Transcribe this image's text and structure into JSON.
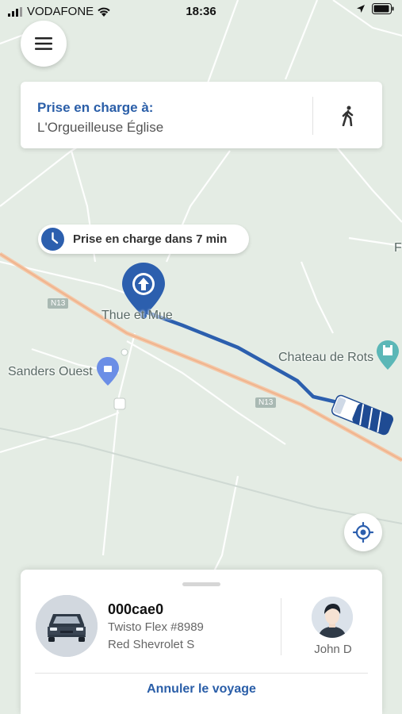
{
  "status_bar": {
    "carrier": "VODAFONE",
    "time": "18:36"
  },
  "pickup": {
    "title": "Prise en charge à:",
    "place": "L'Orgueilleuse Église"
  },
  "eta": {
    "text": "Prise en charge dans 7 min"
  },
  "map": {
    "labels": {
      "thue_et_mue": "Thue et Mue",
      "sanders_ouest": "Sanders Ouest",
      "chateau_de_rots": "Chateau de Rots",
      "edge_f": "F"
    },
    "road_shields": {
      "n13_west": "N13",
      "n13_east": "N13"
    },
    "colors": {
      "route": "#2c5fae",
      "main_road": "#f0b48e",
      "poi_pin": "#6b8ee6",
      "castle_pin": "#5bb7b7"
    }
  },
  "trip": {
    "plate": "000cae0",
    "model": "Twisto Flex #8989",
    "car_description": "Red Shevrolet S",
    "driver_name": "John D",
    "cancel_label": "Annuler le voyage"
  },
  "icons": {
    "menu": "hamburger-icon",
    "walk": "walking-icon",
    "clock": "clock-icon",
    "locate": "crosshair-icon",
    "pickup_pin": "pickup-pin-icon",
    "vehicle": "bus-icon",
    "car": "car-icon",
    "driver": "person-icon"
  }
}
